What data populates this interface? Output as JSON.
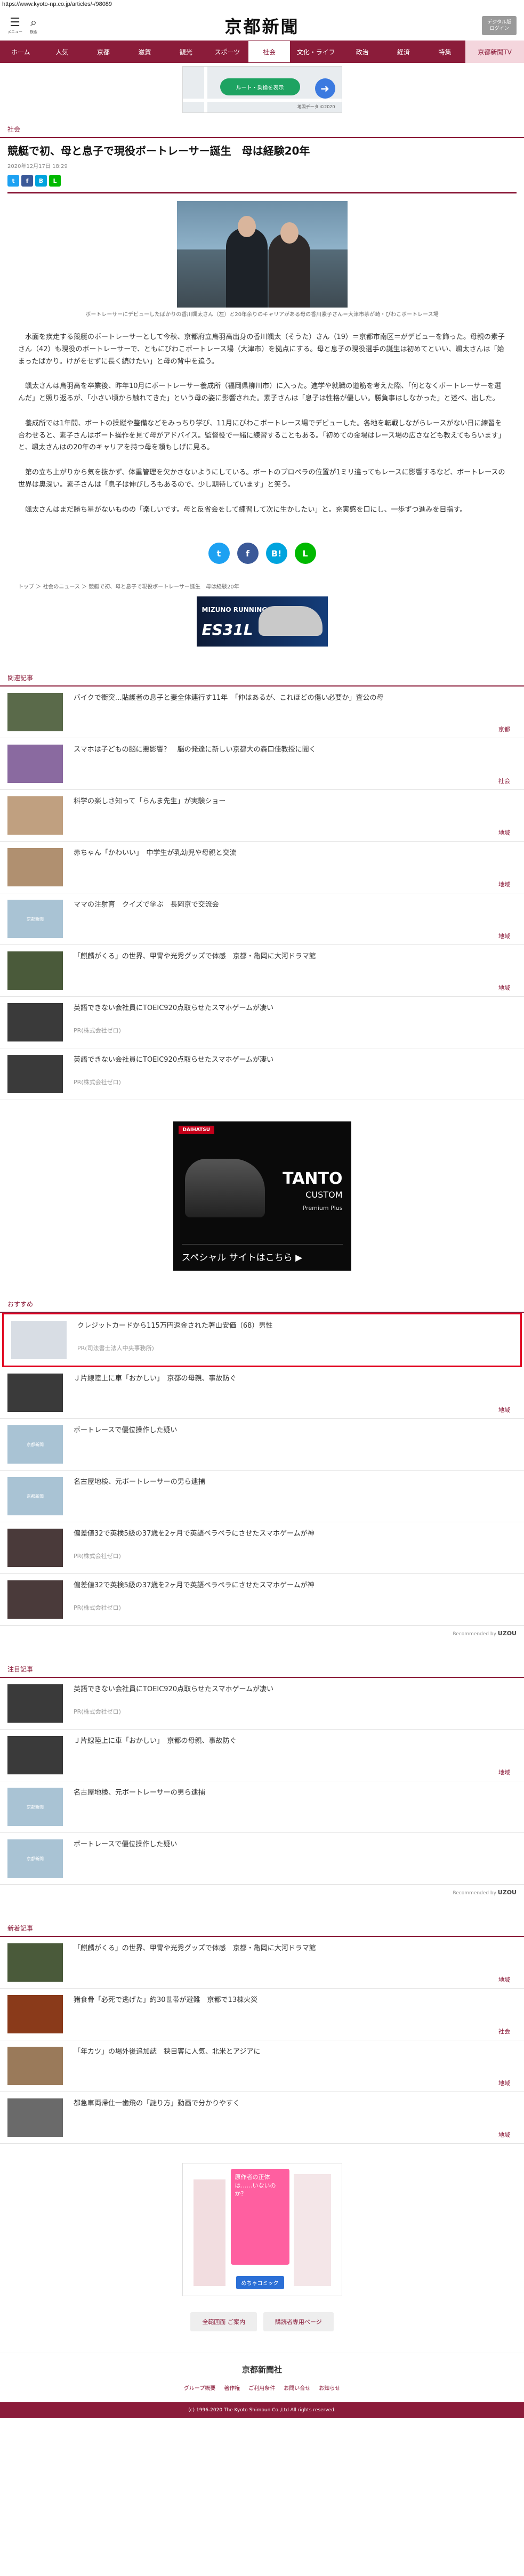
{
  "url": "https://www.kyoto-np.co.jp/articles/-/98089",
  "header": {
    "menu_label": "メニュー",
    "search_label": "検索",
    "logo": "京都新聞",
    "digital_btn": [
      "デジタル版",
      "ログイン"
    ]
  },
  "nav": [
    "ホーム",
    "人気",
    "京都",
    "滋賀",
    "観光",
    "スポーツ",
    "社会",
    "文化・ライフ",
    "政治",
    "経済",
    "特集",
    "京都新聞TV"
  ],
  "map": {
    "pill": "ルート・乗換を表示",
    "caption": "地図データ ©2020"
  },
  "article": {
    "section": "社会",
    "title": "競艇で初、母と息子で現役ボートレーサー誕生　母は経験20年",
    "date": "2020年12月17日 18:29",
    "caption": "ボートレーサーにデビューしたばかりの香川颯太さん（左）と20年余りのキャリアがある母の香川素子さん＝大津市茶が崎・びわこボートレース場",
    "paragraphs": [
      "水面を疾走する競艇のボートレーサーとして今秋、京都府立鳥羽高出身の香川颯太（そうた）さん（19）＝京都市南区＝がデビューを飾った。母親の素子さん（42）も現役のボートレーサーで、ともにびわこボートレース場（大津市）を拠点にする。母と息子の現役選手の誕生は初めてといい、颯太さんは「始まったばかり。けがをせずに長く続けたい」と母の背中を追う。",
      "颯太さんは鳥羽高を卒業後、昨年10月にボートレーサー養成所（福岡県柳川市）に入った。進学や就職の道筋を考えた際、「何となくボートレーサーを選んだ」と照り返るが、「小さい頃から触れてきた」という母の姿に影響された。素子さんは「息子は性格が優しい。勝負事はしなかった」と述べ、出した。",
      "養成所では1年間、ボートの操縦や整備などをみっちり学び、11月にびわこボートレース場でデビューした。各地を転戦しながらレースがない日に練習を合わせると、素子さんはボート操作を見て母がアドバイス。監督役で一緒に練習することもある。「初めての金場はレース場の広さなども教えてもらいます」と、颯太さんはの20年のキャリアを持つ母を頼もしげに見る。",
      "第の立ち上がりから気を抜かず、体重管理を欠かさないようにしている。ボートのプロペラの位置が1ミリ違ってもレースに影響するなど、ボートレースの世界は奥深い。素子さんは「息子は伸びしろもあるので、少し期待しています」と笑う。",
      "颯太さんはまだ勝ち星がないものの「楽しいです。母と反省会をして練習して次に生かしたい」と。充実感を口にし、一歩ずつ進みを目指す。"
    ],
    "breadcrumb": [
      "トップ",
      "社会のニュース",
      "競艇で初、母と息子で現役ボートレーサー誕生　母は経験20年"
    ]
  },
  "banner1": {
    "brand": "MIZUNO RUNNING",
    "model": "ES31L"
  },
  "related": {
    "heading": "関連記事",
    "items": [
      {
        "text": "バイクで衝突…貼護者の息子と妻全体連行す11年　「仲はあるが、これほどの傷い必要か」査公の母",
        "cat": "京都"
      },
      {
        "text": "スマホは子どもの脳に悪影響？　脳の発達に新しい京都大の森口佳教授に聞く",
        "cat": "社会"
      },
      {
        "text": "科学の楽しさ知って「らんま先生」が実験ショー",
        "cat": "地域"
      },
      {
        "text": "赤ちゃん「かわいい」　中学生が乳幼児や母親と交流",
        "cat": "地域"
      },
      {
        "text": "ママの注射育　クイズで学ぶ　長岡京で交流会",
        "cat": "地域"
      },
      {
        "text": "「麒麟がくる」の世界、甲冑や光秀グッズで体感　京都・亀岡に大河ドラマ館",
        "cat": "地域"
      },
      {
        "text": "英語できない会社員にTOEIC920点取らせたスマホゲームが凄い",
        "pr": "PR(株式会社ゼロ)"
      },
      {
        "text": "英語できない会社員にTOEIC920点取らせたスマホゲームが凄い",
        "pr": "PR(株式会社ゼロ)"
      }
    ]
  },
  "ad1": {
    "logo": "DAIHATSU",
    "name": "TANTO",
    "sub": "CUSTOM",
    "line": "Premium Plus",
    "btn": "スペシャル サイトはこちら ▶"
  },
  "recommend": {
    "heading": "おすすめ",
    "items": [
      {
        "text": "クレジットカードから115万円返金された著山安価（68）男性",
        "pr": "PR(司法書士法人中央事務所)"
      },
      {
        "text": "Ｊ片線陸上に車「おかしい」　京都の母親、事故防ぐ",
        "cat": "地域"
      },
      {
        "text": "ボートレースで優位操作した疑い"
      },
      {
        "text": "名古屋地検、元ボートレーサーの男ら逮捕"
      },
      {
        "text": "偏差値32で英検5級の37歳を2ヶ月で英語ペラペラにさせたスマホゲームが神",
        "pr": "PR(株式会社ゼロ)"
      },
      {
        "text": "偏差値32で英検5級の37歳を2ヶ月で英語ペラペラにさせたスマホゲームが神",
        "pr": "PR(株式会社ゼロ)"
      }
    ],
    "by": "Recommended by",
    "brand": "UZOU"
  },
  "attention": {
    "heading": "注目記事",
    "items": [
      {
        "text": "英語できない会社員にTOEIC920点取らせたスマホゲームが凄い",
        "pr": "PR(株式会社ゼロ)"
      },
      {
        "text": "Ｊ片線陸上に車「おかしい」　京都の母親、事故防ぐ",
        "cat": "地域"
      },
      {
        "text": "名古屋地検、元ボートレーサーの男ら逮捕"
      },
      {
        "text": "ボートレースで優位操作した疑い"
      }
    ],
    "by": "Recommended by",
    "brand": "UZOU"
  },
  "latest": {
    "heading": "新着記事",
    "items": [
      {
        "text": "「麒麟がくる」の世界、甲冑や光秀グッズで体感　京都・亀岡に大河ドラマ館",
        "cat": "地域"
      },
      {
        "text": "猪食骨「必死で逃げた」約30世帯が避難　京都で13棟火災",
        "cat": "社会"
      },
      {
        "text": "「年カツ」の場外後追加誌　狭目客に人気、北米とアジアに",
        "cat": "地域"
      },
      {
        "text": "都急車両帰仕一歯飛の「謎り方」動画で分かりやすく",
        "cat": "地域"
      }
    ]
  },
  "ad2": {
    "copy": "原作者の正体は……いないのか？",
    "btn": "めちゃコミック"
  },
  "footer": {
    "buttons": [
      "全範囲面 ご案内",
      "購読者専用ページ"
    ],
    "logo": "京都新聞社",
    "links": [
      "グループ概要",
      "著作権",
      "ご利用条件",
      "お問い合せ",
      "お知らせ"
    ],
    "copyright": "(c) 1996-2020 The Kyoto Shimbun Co.,Ltd All rights reserved."
  }
}
